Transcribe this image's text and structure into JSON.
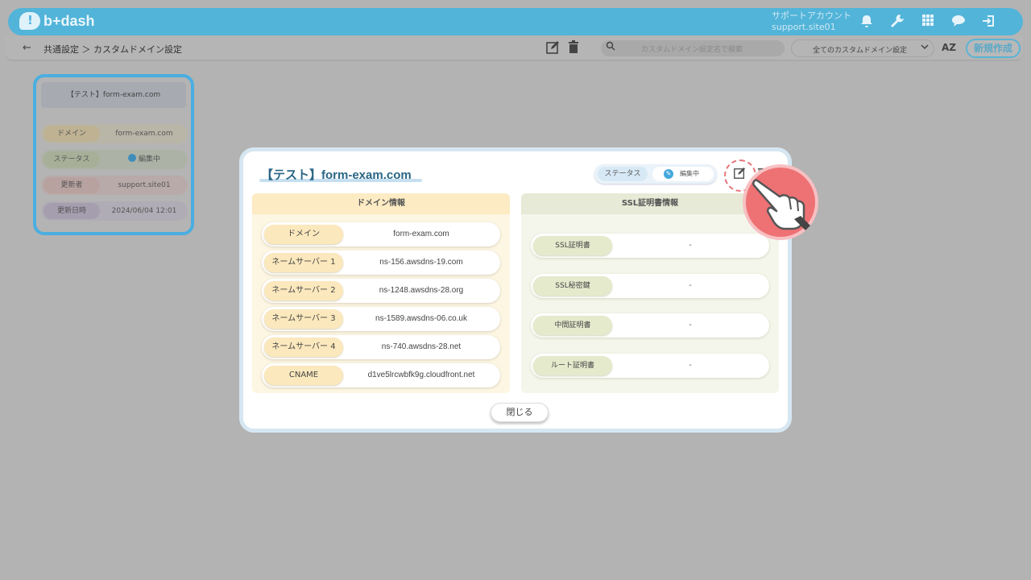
{
  "header": {
    "logo_text": "b+dash",
    "account_label": "サポートアカウント",
    "account_id": "support.site01",
    "icons": [
      "bell-icon",
      "wrench-icon",
      "grid-icon",
      "chat-icon",
      "logout-icon"
    ]
  },
  "subbar": {
    "back_glyph": "←",
    "breadcrumb": "共通設定 ＞ カスタムドメイン設定",
    "search_placeholder": "カスタムドメイン設定名で検索",
    "filter_selected": "全てのカスタムドメイン設定",
    "sort_label": "AZ",
    "new_button": "新規作成"
  },
  "card": {
    "title": "【テスト】form-exam.com",
    "rows": [
      {
        "label": "ドメイン",
        "value": "form-exam.com"
      },
      {
        "label": "ステータス",
        "value": "編集中"
      },
      {
        "label": "更新者",
        "value": "support.site01"
      },
      {
        "label": "更新日時",
        "value": "2024/06/04 12:01"
      }
    ]
  },
  "modal": {
    "title": "【テスト】form-exam.com",
    "status_label": "ステータス",
    "status_value": "編集中",
    "domain_panel": {
      "heading": "ドメイン情報",
      "rows": [
        {
          "label": "ドメイン",
          "value": "form-exam.com"
        },
        {
          "label": "ネームサーバー 1",
          "value": "ns-156.awsdns-19.com"
        },
        {
          "label": "ネームサーバー 2",
          "value": "ns-1248.awsdns-28.org"
        },
        {
          "label": "ネームサーバー 3",
          "value": "ns-1589.awsdns-06.co.uk"
        },
        {
          "label": "ネームサーバー 4",
          "value": "ns-740.awsdns-28.net"
        },
        {
          "label": "CNAME",
          "value": "d1ve5lrcwbfk9g.cloudfront.net"
        }
      ]
    },
    "ssl_panel": {
      "heading": "SSL証明書情報",
      "rows": [
        {
          "label": "SSL証明書",
          "value": "-"
        },
        {
          "label": "SSL秘密鍵",
          "value": "-"
        },
        {
          "label": "中間証明書",
          "value": "-"
        },
        {
          "label": "ルート証明書",
          "value": "-"
        }
      ]
    },
    "close_button": "閉じる"
  }
}
